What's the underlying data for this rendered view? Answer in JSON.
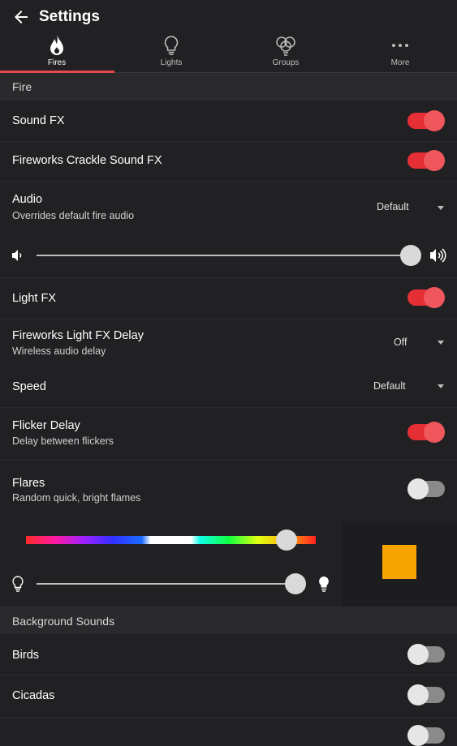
{
  "header": {
    "title": "Settings"
  },
  "tabs": [
    {
      "label": "Fires",
      "icon": "flame-icon",
      "active": true
    },
    {
      "label": "Lights",
      "icon": "bulb-icon",
      "active": false
    },
    {
      "label": "Groups",
      "icon": "groups-icon",
      "active": false
    },
    {
      "label": "More",
      "icon": "more-dots-icon",
      "active": false
    }
  ],
  "fire_section": {
    "title": "Fire",
    "sound_fx": {
      "label": "Sound FX",
      "on": true
    },
    "crackle": {
      "label": "Fireworks Crackle Sound FX",
      "on": true
    },
    "audio": {
      "label": "Audio",
      "sublabel": "Overrides default fire audio",
      "value": "Default"
    },
    "volume": {
      "level": 1.0
    },
    "light_fx": {
      "label": "Light FX",
      "on": true
    },
    "light_delay": {
      "label": "Fireworks Light FX Delay",
      "sublabel": "Wireless audio delay",
      "value": "Off"
    },
    "speed": {
      "label": "Speed",
      "value": "Default"
    },
    "flicker": {
      "label": "Flicker Delay",
      "sublabel": "Delay between flickers",
      "on": true
    },
    "flares": {
      "label": "Flares",
      "sublabel": "Random quick, bright flames",
      "on": false
    },
    "color": {
      "hue_position": 0.9,
      "brightness": 0.95,
      "swatch": "#f7a400"
    }
  },
  "background_section": {
    "title": "Background Sounds",
    "birds": {
      "label": "Birds",
      "on": false
    },
    "cicadas": {
      "label": "Cicadas",
      "on": false
    }
  },
  "colors": {
    "accent": "#e62f35",
    "indicator": "#e5484d",
    "background": "#212124"
  }
}
